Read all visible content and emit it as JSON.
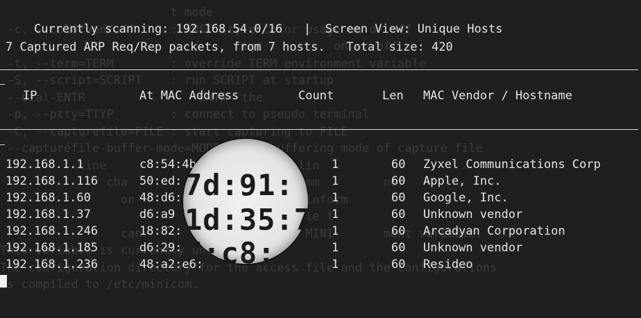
{
  "status_bar": {
    "scanning_label": "Currently scanning: 192.168.54.0/16",
    "separator": "|",
    "view_label": "Screen View: Unique Hosts"
  },
  "summary": "7 Captured ARP Req/Rep packets, from 7 hosts.   Total size: 420",
  "table": {
    "headers": {
      "ip": "IP",
      "mac": "At MAC Address",
      "count": "Count",
      "len": "Len",
      "vendor": "MAC Vendor / Hostname"
    },
    "rows": [
      {
        "ip": "192.168.1.1",
        "mac": "c8:54:4b",
        "count": "1",
        "len": "60",
        "vendor": "Zyxel Communications Corp"
      },
      {
        "ip": "192.168.1.116",
        "mac": "50:ed:",
        "count": "1",
        "len": "60",
        "vendor": "Apple, Inc."
      },
      {
        "ip": "192.168.1.60",
        "mac": "48:d6:",
        "count": "1",
        "len": "60",
        "vendor": "Google, Inc."
      },
      {
        "ip": "192.168.1.37",
        "mac": "d6:a9",
        "count": "1",
        "len": "60",
        "vendor": "Unknown vendor"
      },
      {
        "ip": "192.168.1.246",
        "mac": "18:82:",
        "count": "1",
        "len": "60",
        "vendor": "Arcadyan Corporation"
      },
      {
        "ip": "192.168.1.185",
        "mac": "d6:29:",
        "count": "1",
        "len": "60",
        "vendor": "Unknown vendor"
      },
      {
        "ip": "192.168.1.236",
        "mac": "48:a2:e6:",
        "count": "1",
        "len": "60",
        "vendor": "Resideo"
      }
    ]
  },
  "magnifier": {
    "lines": [
      "7d:91:",
      "1d:35:7",
      "7:c8:"
    ]
  },
  "background_text": [
    "                        t mode",
    " -c, --color=on/off     : ANSI style color usage on or off",
    "                                 ligt          on or off",
    " -t, --term=TERM        : override TERM environment variable",
    " -S, --script=SCRIPT    : run SCRIPT at startup",
    " --dial-ENTR                ENTR  the",
    " -p, --ptty=TTYP        : connect to pseudo terminal",
    " -C, --capturefile=FILE : start capturing to FILE",
    " --capturefile-buffer-mode=MODE : set buffering mode of capture file",
    "           line                 of status lin",
    "               cha                set of comm         ner",
    "                 on                ersion  inform",
    "                                   ation file t",
    "                 can              d in the MINI       ment variable.",
    "This variable is currently unset.",
    "The configuration directory for the access file and the configurations",
    "is compiled to /etc/minicom."
  ],
  "colors": {
    "background": "#1f1f22",
    "foreground": "#e6e6e6",
    "ghost_text": "#3a3a3f"
  }
}
